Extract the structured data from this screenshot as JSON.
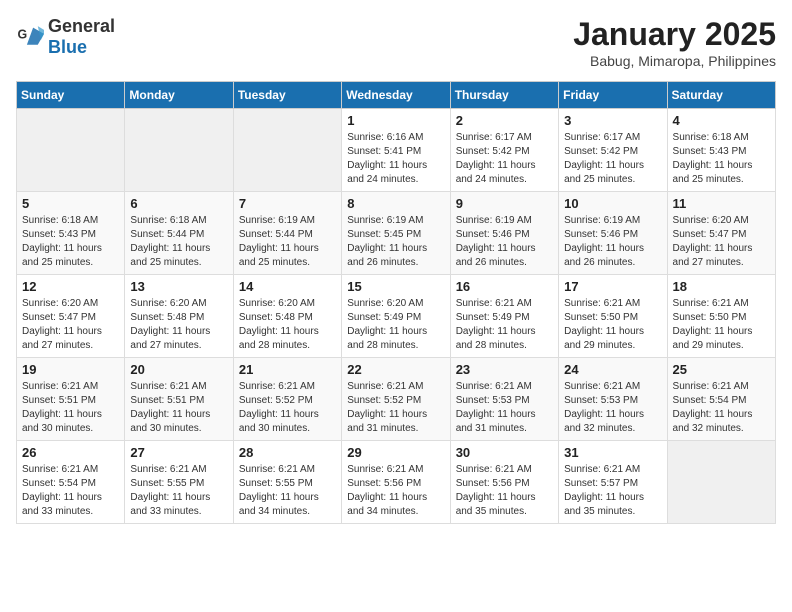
{
  "header": {
    "logo_general": "General",
    "logo_blue": "Blue",
    "title": "January 2025",
    "subtitle": "Babug, Mimaropa, Philippines"
  },
  "days_of_week": [
    "Sunday",
    "Monday",
    "Tuesday",
    "Wednesday",
    "Thursday",
    "Friday",
    "Saturday"
  ],
  "weeks": [
    [
      {
        "day": "",
        "empty": true
      },
      {
        "day": "",
        "empty": true
      },
      {
        "day": "",
        "empty": true
      },
      {
        "day": "1",
        "sunrise": "6:16 AM",
        "sunset": "5:41 PM",
        "daylight": "11 hours and 24 minutes."
      },
      {
        "day": "2",
        "sunrise": "6:17 AM",
        "sunset": "5:42 PM",
        "daylight": "11 hours and 24 minutes."
      },
      {
        "day": "3",
        "sunrise": "6:17 AM",
        "sunset": "5:42 PM",
        "daylight": "11 hours and 25 minutes."
      },
      {
        "day": "4",
        "sunrise": "6:18 AM",
        "sunset": "5:43 PM",
        "daylight": "11 hours and 25 minutes."
      }
    ],
    [
      {
        "day": "5",
        "sunrise": "6:18 AM",
        "sunset": "5:43 PM",
        "daylight": "11 hours and 25 minutes."
      },
      {
        "day": "6",
        "sunrise": "6:18 AM",
        "sunset": "5:44 PM",
        "daylight": "11 hours and 25 minutes."
      },
      {
        "day": "7",
        "sunrise": "6:19 AM",
        "sunset": "5:44 PM",
        "daylight": "11 hours and 25 minutes."
      },
      {
        "day": "8",
        "sunrise": "6:19 AM",
        "sunset": "5:45 PM",
        "daylight": "11 hours and 26 minutes."
      },
      {
        "day": "9",
        "sunrise": "6:19 AM",
        "sunset": "5:46 PM",
        "daylight": "11 hours and 26 minutes."
      },
      {
        "day": "10",
        "sunrise": "6:19 AM",
        "sunset": "5:46 PM",
        "daylight": "11 hours and 26 minutes."
      },
      {
        "day": "11",
        "sunrise": "6:20 AM",
        "sunset": "5:47 PM",
        "daylight": "11 hours and 27 minutes."
      }
    ],
    [
      {
        "day": "12",
        "sunrise": "6:20 AM",
        "sunset": "5:47 PM",
        "daylight": "11 hours and 27 minutes."
      },
      {
        "day": "13",
        "sunrise": "6:20 AM",
        "sunset": "5:48 PM",
        "daylight": "11 hours and 27 minutes."
      },
      {
        "day": "14",
        "sunrise": "6:20 AM",
        "sunset": "5:48 PM",
        "daylight": "11 hours and 28 minutes."
      },
      {
        "day": "15",
        "sunrise": "6:20 AM",
        "sunset": "5:49 PM",
        "daylight": "11 hours and 28 minutes."
      },
      {
        "day": "16",
        "sunrise": "6:21 AM",
        "sunset": "5:49 PM",
        "daylight": "11 hours and 28 minutes."
      },
      {
        "day": "17",
        "sunrise": "6:21 AM",
        "sunset": "5:50 PM",
        "daylight": "11 hours and 29 minutes."
      },
      {
        "day": "18",
        "sunrise": "6:21 AM",
        "sunset": "5:50 PM",
        "daylight": "11 hours and 29 minutes."
      }
    ],
    [
      {
        "day": "19",
        "sunrise": "6:21 AM",
        "sunset": "5:51 PM",
        "daylight": "11 hours and 30 minutes."
      },
      {
        "day": "20",
        "sunrise": "6:21 AM",
        "sunset": "5:51 PM",
        "daylight": "11 hours and 30 minutes."
      },
      {
        "day": "21",
        "sunrise": "6:21 AM",
        "sunset": "5:52 PM",
        "daylight": "11 hours and 30 minutes."
      },
      {
        "day": "22",
        "sunrise": "6:21 AM",
        "sunset": "5:52 PM",
        "daylight": "11 hours and 31 minutes."
      },
      {
        "day": "23",
        "sunrise": "6:21 AM",
        "sunset": "5:53 PM",
        "daylight": "11 hours and 31 minutes."
      },
      {
        "day": "24",
        "sunrise": "6:21 AM",
        "sunset": "5:53 PM",
        "daylight": "11 hours and 32 minutes."
      },
      {
        "day": "25",
        "sunrise": "6:21 AM",
        "sunset": "5:54 PM",
        "daylight": "11 hours and 32 minutes."
      }
    ],
    [
      {
        "day": "26",
        "sunrise": "6:21 AM",
        "sunset": "5:54 PM",
        "daylight": "11 hours and 33 minutes."
      },
      {
        "day": "27",
        "sunrise": "6:21 AM",
        "sunset": "5:55 PM",
        "daylight": "11 hours and 33 minutes."
      },
      {
        "day": "28",
        "sunrise": "6:21 AM",
        "sunset": "5:55 PM",
        "daylight": "11 hours and 34 minutes."
      },
      {
        "day": "29",
        "sunrise": "6:21 AM",
        "sunset": "5:56 PM",
        "daylight": "11 hours and 34 minutes."
      },
      {
        "day": "30",
        "sunrise": "6:21 AM",
        "sunset": "5:56 PM",
        "daylight": "11 hours and 35 minutes."
      },
      {
        "day": "31",
        "sunrise": "6:21 AM",
        "sunset": "5:57 PM",
        "daylight": "11 hours and 35 minutes."
      },
      {
        "day": "",
        "empty": true
      }
    ]
  ]
}
